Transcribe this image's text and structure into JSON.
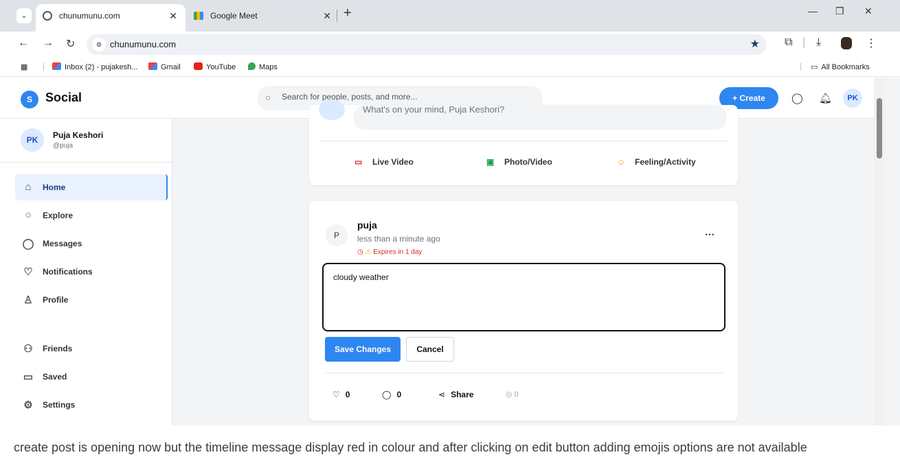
{
  "browser": {
    "tabs": [
      {
        "label": "chunumunu.com",
        "active": true
      },
      {
        "label": "Google Meet",
        "active": false
      }
    ],
    "url": "chunumunu.com",
    "bookmarks": [
      {
        "label": "Inbox (2) - pujakesh...",
        "icon": "gmail-icon"
      },
      {
        "label": "Gmail",
        "icon": "gmail-icon"
      },
      {
        "label": "YouTube",
        "icon": "youtube-icon"
      },
      {
        "label": "Maps",
        "icon": "maps-icon"
      }
    ],
    "all_bookmarks": "All Bookmarks"
  },
  "app": {
    "logo_letter": "S",
    "name": "Social",
    "search_placeholder": "Search for people, posts, and more...",
    "create_label": "+ Create",
    "user_initials": "PK",
    "accent_color": "#2e86f0"
  },
  "sidebar": {
    "user": {
      "initials": "PK",
      "name": "Puja Keshori",
      "handle": "@puja"
    },
    "items": [
      {
        "label": "Home",
        "icon": "home-icon",
        "active": true
      },
      {
        "label": "Explore",
        "icon": "search-icon"
      },
      {
        "label": "Messages",
        "icon": "message-icon"
      },
      {
        "label": "Notifications",
        "icon": "heart-icon"
      },
      {
        "label": "Profile",
        "icon": "user-icon"
      },
      {
        "label": "Friends",
        "icon": "friends-icon"
      },
      {
        "label": "Saved",
        "icon": "bookmark-icon"
      },
      {
        "label": "Settings",
        "icon": "gear-icon"
      }
    ]
  },
  "composer": {
    "initials": "PK",
    "placeholder": "What's on your mind, Puja Keshori?",
    "actions": [
      {
        "label": "Live Video",
        "icon": "video-icon",
        "color": "#dc2626"
      },
      {
        "label": "Photo/Video",
        "icon": "image-icon",
        "color": "#16a34a"
      },
      {
        "label": "Feeling/Activity",
        "icon": "smile-icon",
        "color": "#eab308"
      }
    ]
  },
  "post": {
    "avatar": "P",
    "author": "puja",
    "time": "less than a minute ago",
    "expires": "Expires in 1 day",
    "expires_color": "#dc2626",
    "edit_text": "cloudy weather",
    "save_label": "Save Changes",
    "cancel_label": "Cancel",
    "likes": "0",
    "comments": "0",
    "share_label": "Share",
    "views": "0"
  },
  "caption": "create post is opening now but the timeline message display red in colour and after clicking on edit button adding emojis options are not available"
}
